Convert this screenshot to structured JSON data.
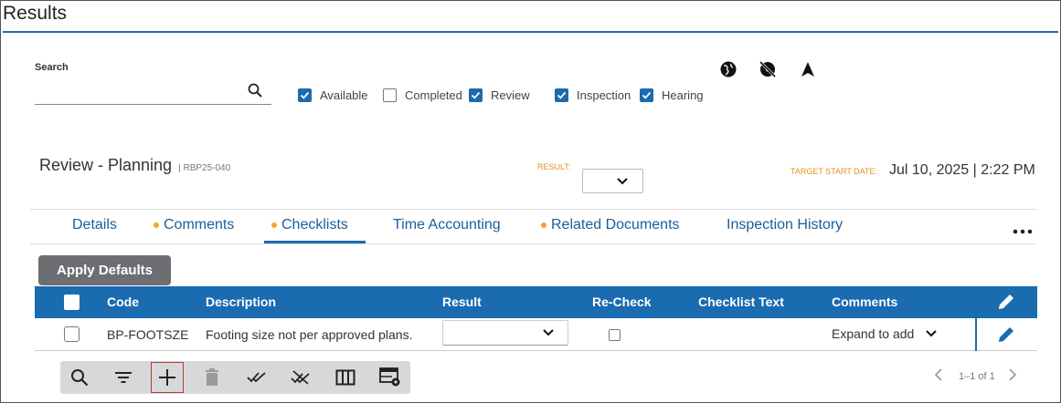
{
  "page": {
    "title": "Results"
  },
  "search": {
    "label": "Search",
    "value": "",
    "placeholder": ""
  },
  "filters": [
    {
      "label": "Available",
      "checked": true
    },
    {
      "label": "Completed",
      "checked": false
    },
    {
      "label": "Review",
      "checked": true
    },
    {
      "label": "Inspection",
      "checked": true
    },
    {
      "label": "Hearing",
      "checked": true
    }
  ],
  "top_icons": [
    "globe-icon",
    "globe-off-icon",
    "navigation-arrow-icon"
  ],
  "record": {
    "title": "Review - Planning",
    "number": "| RBP25-040",
    "result_label": "RESULT:",
    "result_value": "",
    "target_start_label": "TARGET START DATE:",
    "target_start_value": "Jul 10, 2025 | 2:22 PM"
  },
  "tabs": [
    {
      "label": "Details",
      "dot": false,
      "active": false
    },
    {
      "label": "Comments",
      "dot": true,
      "active": false
    },
    {
      "label": "Checklists",
      "dot": true,
      "active": true
    },
    {
      "label": "Time Accounting",
      "dot": false,
      "active": false
    },
    {
      "label": "Related Documents",
      "dot": true,
      "active": false
    },
    {
      "label": "Inspection History",
      "dot": false,
      "active": false
    }
  ],
  "apply_defaults_label": "Apply Defaults",
  "table": {
    "columns": [
      "Code",
      "Description",
      "Result",
      "Re-Check",
      "Checklist Text",
      "Comments"
    ],
    "rows": [
      {
        "code": "BP-FOOTSZE",
        "description": "Footing size not per approved plans.",
        "result": "",
        "recheck": false,
        "checklist_text": "",
        "comments": "Expand to add"
      }
    ]
  },
  "toolbar": {
    "buttons": [
      "search-icon",
      "filter-icon",
      "add-icon",
      "delete-icon",
      "check-all-icon",
      "uncheck-all-icon",
      "columns-icon",
      "table-settings-icon"
    ]
  },
  "pager": {
    "text": "1–1 of 1"
  },
  "colors": {
    "accent": "#1a6bb0",
    "dot": "#f5a623",
    "label_orange": "#e0921f",
    "toolbar_bg": "#d7d8d9",
    "button_gray": "#6d6e72"
  }
}
